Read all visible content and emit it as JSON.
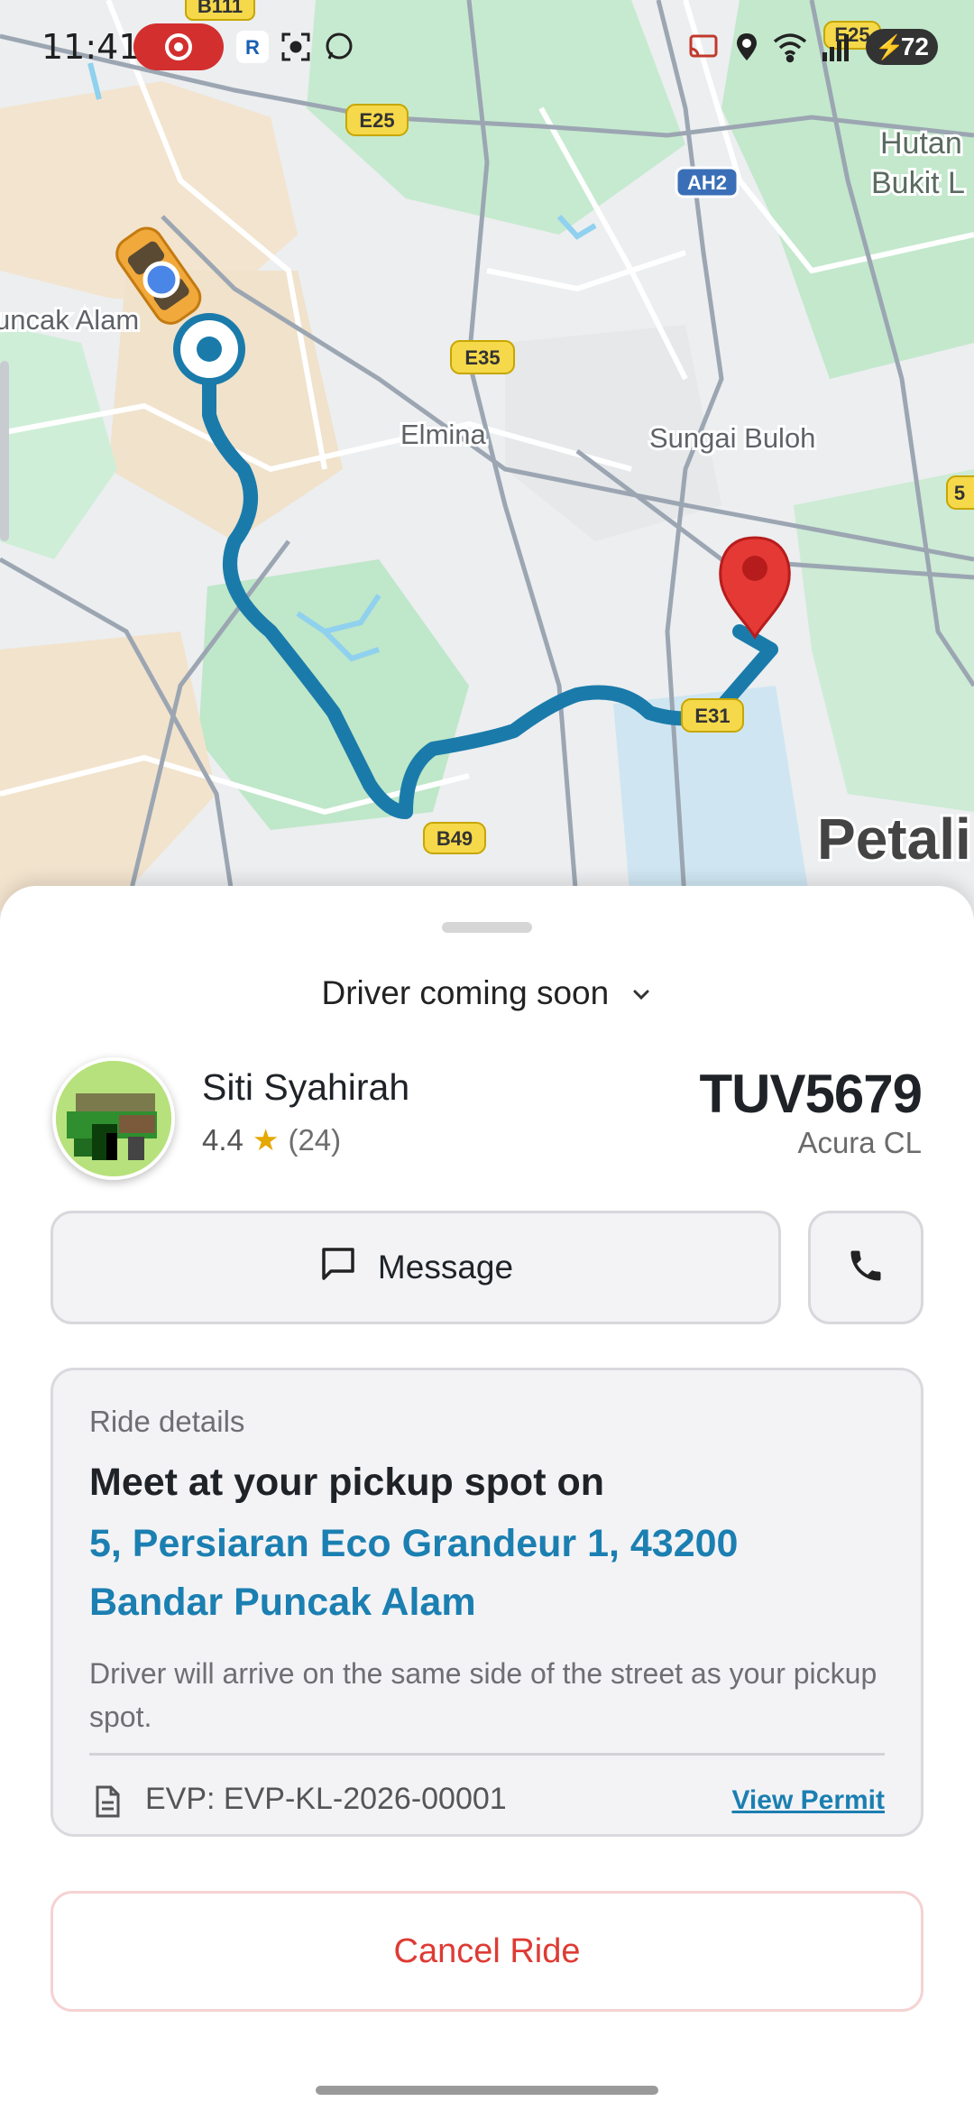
{
  "status_bar": {
    "time": "11:41",
    "battery": "72",
    "icons": [
      "screen-record-icon",
      "app-logo-icon",
      "screen-capture-icon",
      "whatsapp-icon",
      "cast-icon",
      "location-icon",
      "wifi-icon",
      "signal-icon",
      "battery-icon"
    ]
  },
  "map": {
    "labels": {
      "puncak_alam": "uncak Alam",
      "elmina": "Elmina",
      "sungai_buloh": "Sungai Buloh",
      "hutan_1": "Hutan",
      "hutan_2": "Bukit L",
      "petaling": "Petali"
    },
    "shields": {
      "b111": "B111",
      "e25": "E25",
      "e25b": "E25",
      "ah2": "AH2",
      "e35": "E35",
      "e31": "E31",
      "b49": "B49",
      "e5": "5"
    },
    "colors": {
      "route": "#1a7bab",
      "pin": "#e53935",
      "pickup": "#1a7bab"
    }
  },
  "sheet": {
    "status": "Driver coming soon",
    "driver": {
      "name": "Siti Syahirah",
      "rating": "4.4",
      "rating_count": "(24)"
    },
    "vehicle": {
      "plate": "TUV5679",
      "model": "Acura CL"
    },
    "buttons": {
      "message": "Message",
      "cancel": "Cancel Ride"
    },
    "details": {
      "title": "Ride details",
      "heading": "Meet at your pickup spot on",
      "address": "5, Persiaran Eco Grandeur 1, 43200 Bandar Puncak Alam",
      "note": "Driver will arrive on the same side of the street as your pickup spot.",
      "evp": "EVP: EVP-KL-2026-00001",
      "view_permit": "View Permit"
    }
  }
}
